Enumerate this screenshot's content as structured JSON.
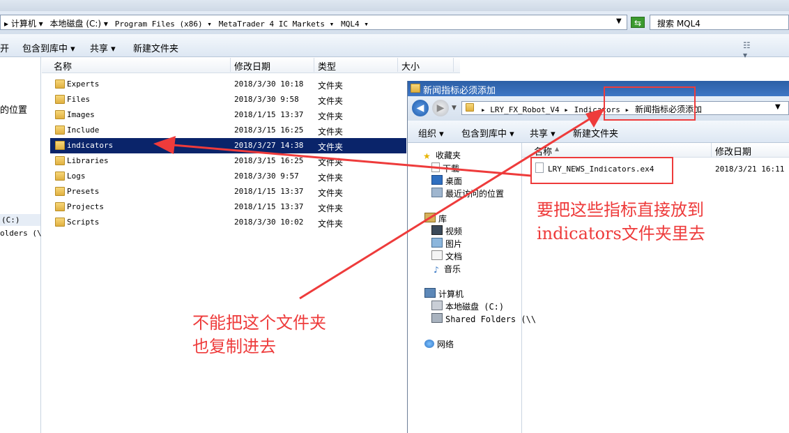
{
  "main": {
    "breadcrumbs": [
      "▸ 计算机 ▾",
      "本地磁盘 (C:) ▾",
      "Program Files (x86) ▾",
      "MetaTrader 4 IC Markets ▾",
      "MQL4 ▾"
    ],
    "search_placeholder": "搜索 MQL4",
    "toolbar": {
      "open": "开",
      "include": "包含到库中 ▾",
      "share": "共享 ▾",
      "new_folder": "新建文件夹"
    },
    "nav_fragments": {
      "recent": "的位置",
      "drive": "(C:)",
      "shared": "olders (\\\\"
    },
    "columns": {
      "name": "名称",
      "date": "修改日期",
      "type": "类型",
      "size": "大小"
    },
    "rows": [
      {
        "name": "Experts",
        "date": "2018/3/30 10:18",
        "type": "文件夹"
      },
      {
        "name": "Files",
        "date": "2018/3/30 9:58",
        "type": "文件夹"
      },
      {
        "name": "Images",
        "date": "2018/1/15 13:37",
        "type": "文件夹"
      },
      {
        "name": "Include",
        "date": "2018/3/15 16:25",
        "type": "文件夹"
      },
      {
        "name": "indicators",
        "date": "2018/3/27 14:38",
        "type": "文件夹"
      },
      {
        "name": "Libraries",
        "date": "2018/3/15 16:25",
        "type": "文件夹"
      },
      {
        "name": "Logs",
        "date": "2018/3/30 9:57",
        "type": "文件夹"
      },
      {
        "name": "Presets",
        "date": "2018/1/15 13:37",
        "type": "文件夹"
      },
      {
        "name": "Projects",
        "date": "2018/1/15 13:37",
        "type": "文件夹"
      },
      {
        "name": "Scripts",
        "date": "2018/3/30 10:02",
        "type": "文件夹"
      }
    ]
  },
  "second": {
    "title": "新闻指标必须添加",
    "breadcrumbs": [
      "▸ LRY_FX_Robot_V4 ▸",
      "Indicators ▸",
      "新闻指标必须添加"
    ],
    "toolbar": {
      "organize": "组织 ▾",
      "include": "包含到库中 ▾",
      "share": "共享 ▾",
      "new_folder": "新建文件夹"
    },
    "nav": [
      {
        "label": "收藏夹",
        "icon": "star-icon"
      },
      {
        "label": "下载",
        "icon": "download-icon"
      },
      {
        "label": "桌面",
        "icon": "desktop-icon"
      },
      {
        "label": "最近访问的位置",
        "icon": "recent-icon"
      },
      {
        "label": "库",
        "icon": "library-icon"
      },
      {
        "label": "视频",
        "icon": "video-icon"
      },
      {
        "label": "图片",
        "icon": "picture-icon"
      },
      {
        "label": "文档",
        "icon": "document-icon"
      },
      {
        "label": "音乐",
        "icon": "music-icon"
      },
      {
        "label": "计算机",
        "icon": "computer-icon"
      },
      {
        "label": "本地磁盘 (C:)",
        "icon": "drive-icon"
      },
      {
        "label": "Shared Folders (\\\\",
        "icon": "network-drive-icon"
      },
      {
        "label": "网络",
        "icon": "network-icon"
      }
    ],
    "columns": {
      "name": "名称",
      "date": "修改日期"
    },
    "file": {
      "name": "LRY_NEWS_Indicators.ex4",
      "date": "2018/3/21 16:11"
    }
  },
  "annotations": {
    "note1_line1": "要把这些指标直接放到",
    "note1_line2": "indicators文件夹里去",
    "note2_line1": "不能把这个文件夹",
    "note2_line2": "也复制进去",
    "color": "#ee3b3b"
  }
}
